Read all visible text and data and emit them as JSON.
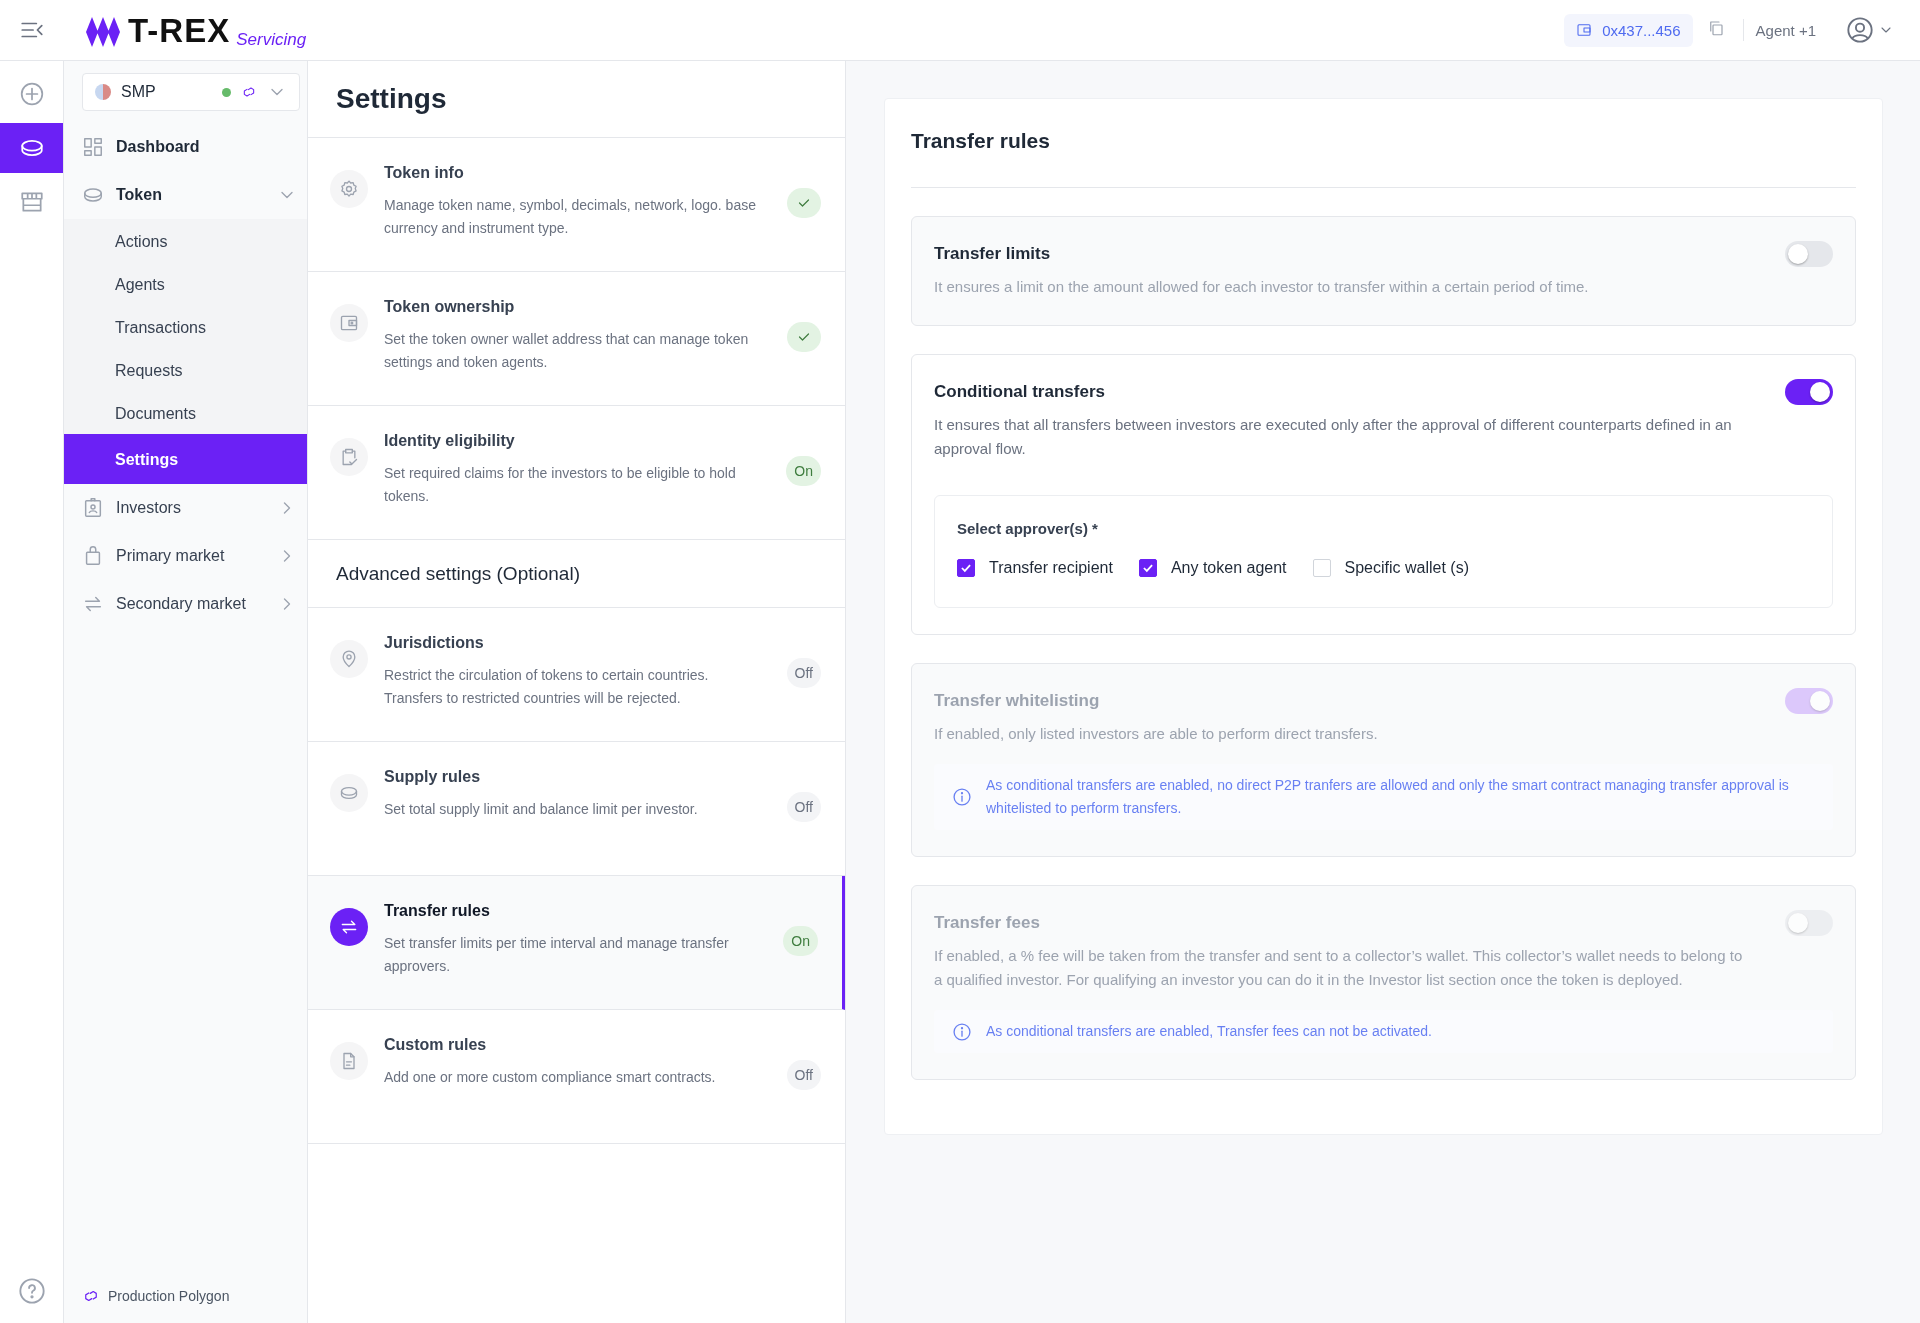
{
  "header": {
    "logo_text": "T-REX",
    "logo_sub": "Servicing",
    "wallet": "0x437...456",
    "agent": "Agent +1"
  },
  "rail": [
    {
      "kind": "add",
      "selected": false
    },
    {
      "kind": "token",
      "selected": true
    },
    {
      "kind": "store",
      "selected": false
    }
  ],
  "sidebar": {
    "token_selector": {
      "name": "SMP"
    },
    "nav": [
      {
        "label": "Dashboard",
        "kind": "dashboard"
      },
      {
        "label": "Token",
        "kind": "token",
        "expanded": true,
        "children": [
          {
            "label": "Actions",
            "selected": false
          },
          {
            "label": "Agents",
            "selected": false
          },
          {
            "label": "Transactions",
            "selected": false
          },
          {
            "label": "Requests",
            "selected": false
          },
          {
            "label": "Documents",
            "selected": false
          },
          {
            "label": "Settings",
            "selected": true
          }
        ]
      },
      {
        "label": "Investors",
        "kind": "investors",
        "expanded": false
      },
      {
        "label": "Primary market",
        "kind": "bag",
        "expanded": false
      },
      {
        "label": "Secondary market",
        "kind": "swap",
        "expanded": false
      }
    ],
    "network": "Production Polygon"
  },
  "settings": {
    "title": "Settings",
    "groups": [
      {
        "items": [
          {
            "title": "Token info",
            "description": "Manage token name, symbol, decimals, network, logo. base currency and instrument type.",
            "kind": "gear",
            "done": true,
            "selected": false
          },
          {
            "title": "Token ownership",
            "description": "Set the token owner wallet address that can manage token settings and token agents.",
            "kind": "wallet",
            "done": true,
            "selected": false
          },
          {
            "title": "Identity eligibility",
            "description": "Set required claims for the investors to be eligible to hold tokens.",
            "kind": "clipboard",
            "done": false,
            "on": true,
            "status_label": "On",
            "selected": false
          }
        ]
      },
      {
        "heading": "Advanced settings (Optional)",
        "items": [
          {
            "title": "Jurisdictions",
            "description": "Restrict the circulation of tokens to certain countries. Transfers to restricted countries will be rejected.",
            "kind": "pin",
            "done": false,
            "on": false,
            "status_label": "Off",
            "selected": false
          },
          {
            "title": "Supply rules",
            "description": "Set total supply limit and balance limit per investor.",
            "kind": "coin",
            "done": false,
            "on": false,
            "status_label": "Off",
            "selected": false
          },
          {
            "title": "Transfer rules",
            "description": "Set transfer limits per time interval and manage transfer approvers.",
            "kind": "swap",
            "done": false,
            "on": true,
            "status_label": "On",
            "selected": true
          },
          {
            "title": "Custom rules",
            "description": "Add one or more custom compliance smart contracts.",
            "kind": "doc",
            "done": false,
            "on": false,
            "status_label": "Off",
            "selected": false
          }
        ]
      }
    ]
  },
  "panel": {
    "title": "Transfer rules",
    "rules": [
      {
        "title": "Transfer limits",
        "description": "It ensures a limit on the amount allowed for each investor to transfer within a certain period of time.",
        "on": false,
        "disabled": false
      },
      {
        "title": "Conditional transfers",
        "description": "It ensures that all transfers between investors are executed only after the approval of different counterparts defined in an approval flow.",
        "on": true,
        "disabled": false,
        "approvers": {
          "label": "Select approver(s) *",
          "options": [
            {
              "label": "Transfer recipient",
              "checked": true
            },
            {
              "label": "Any token agent",
              "checked": true
            },
            {
              "label": "Specific wallet (s)",
              "checked": false
            }
          ]
        }
      },
      {
        "title": "Transfer whitelisting",
        "description": "If enabled, only listed investors are able to perform direct transfers.",
        "on": true,
        "disabled": true,
        "notice": "As conditional transfers are enabled, no direct P2P tranfers are allowed and only the smart contract managing transfer approval is whitelisted to perform transfers."
      },
      {
        "title": "Transfer fees",
        "description": "If enabled, a % fee will be taken from the transfer and sent to a collector’s wallet. This collector’s wallet needs to belong to a qualified investor. For qualifying an investor you can do it in the Investor list section once the token is deployed.",
        "on": false,
        "disabled": true,
        "notice": "As conditional transfers are enabled, Transfer fees can not be activated."
      }
    ]
  }
}
